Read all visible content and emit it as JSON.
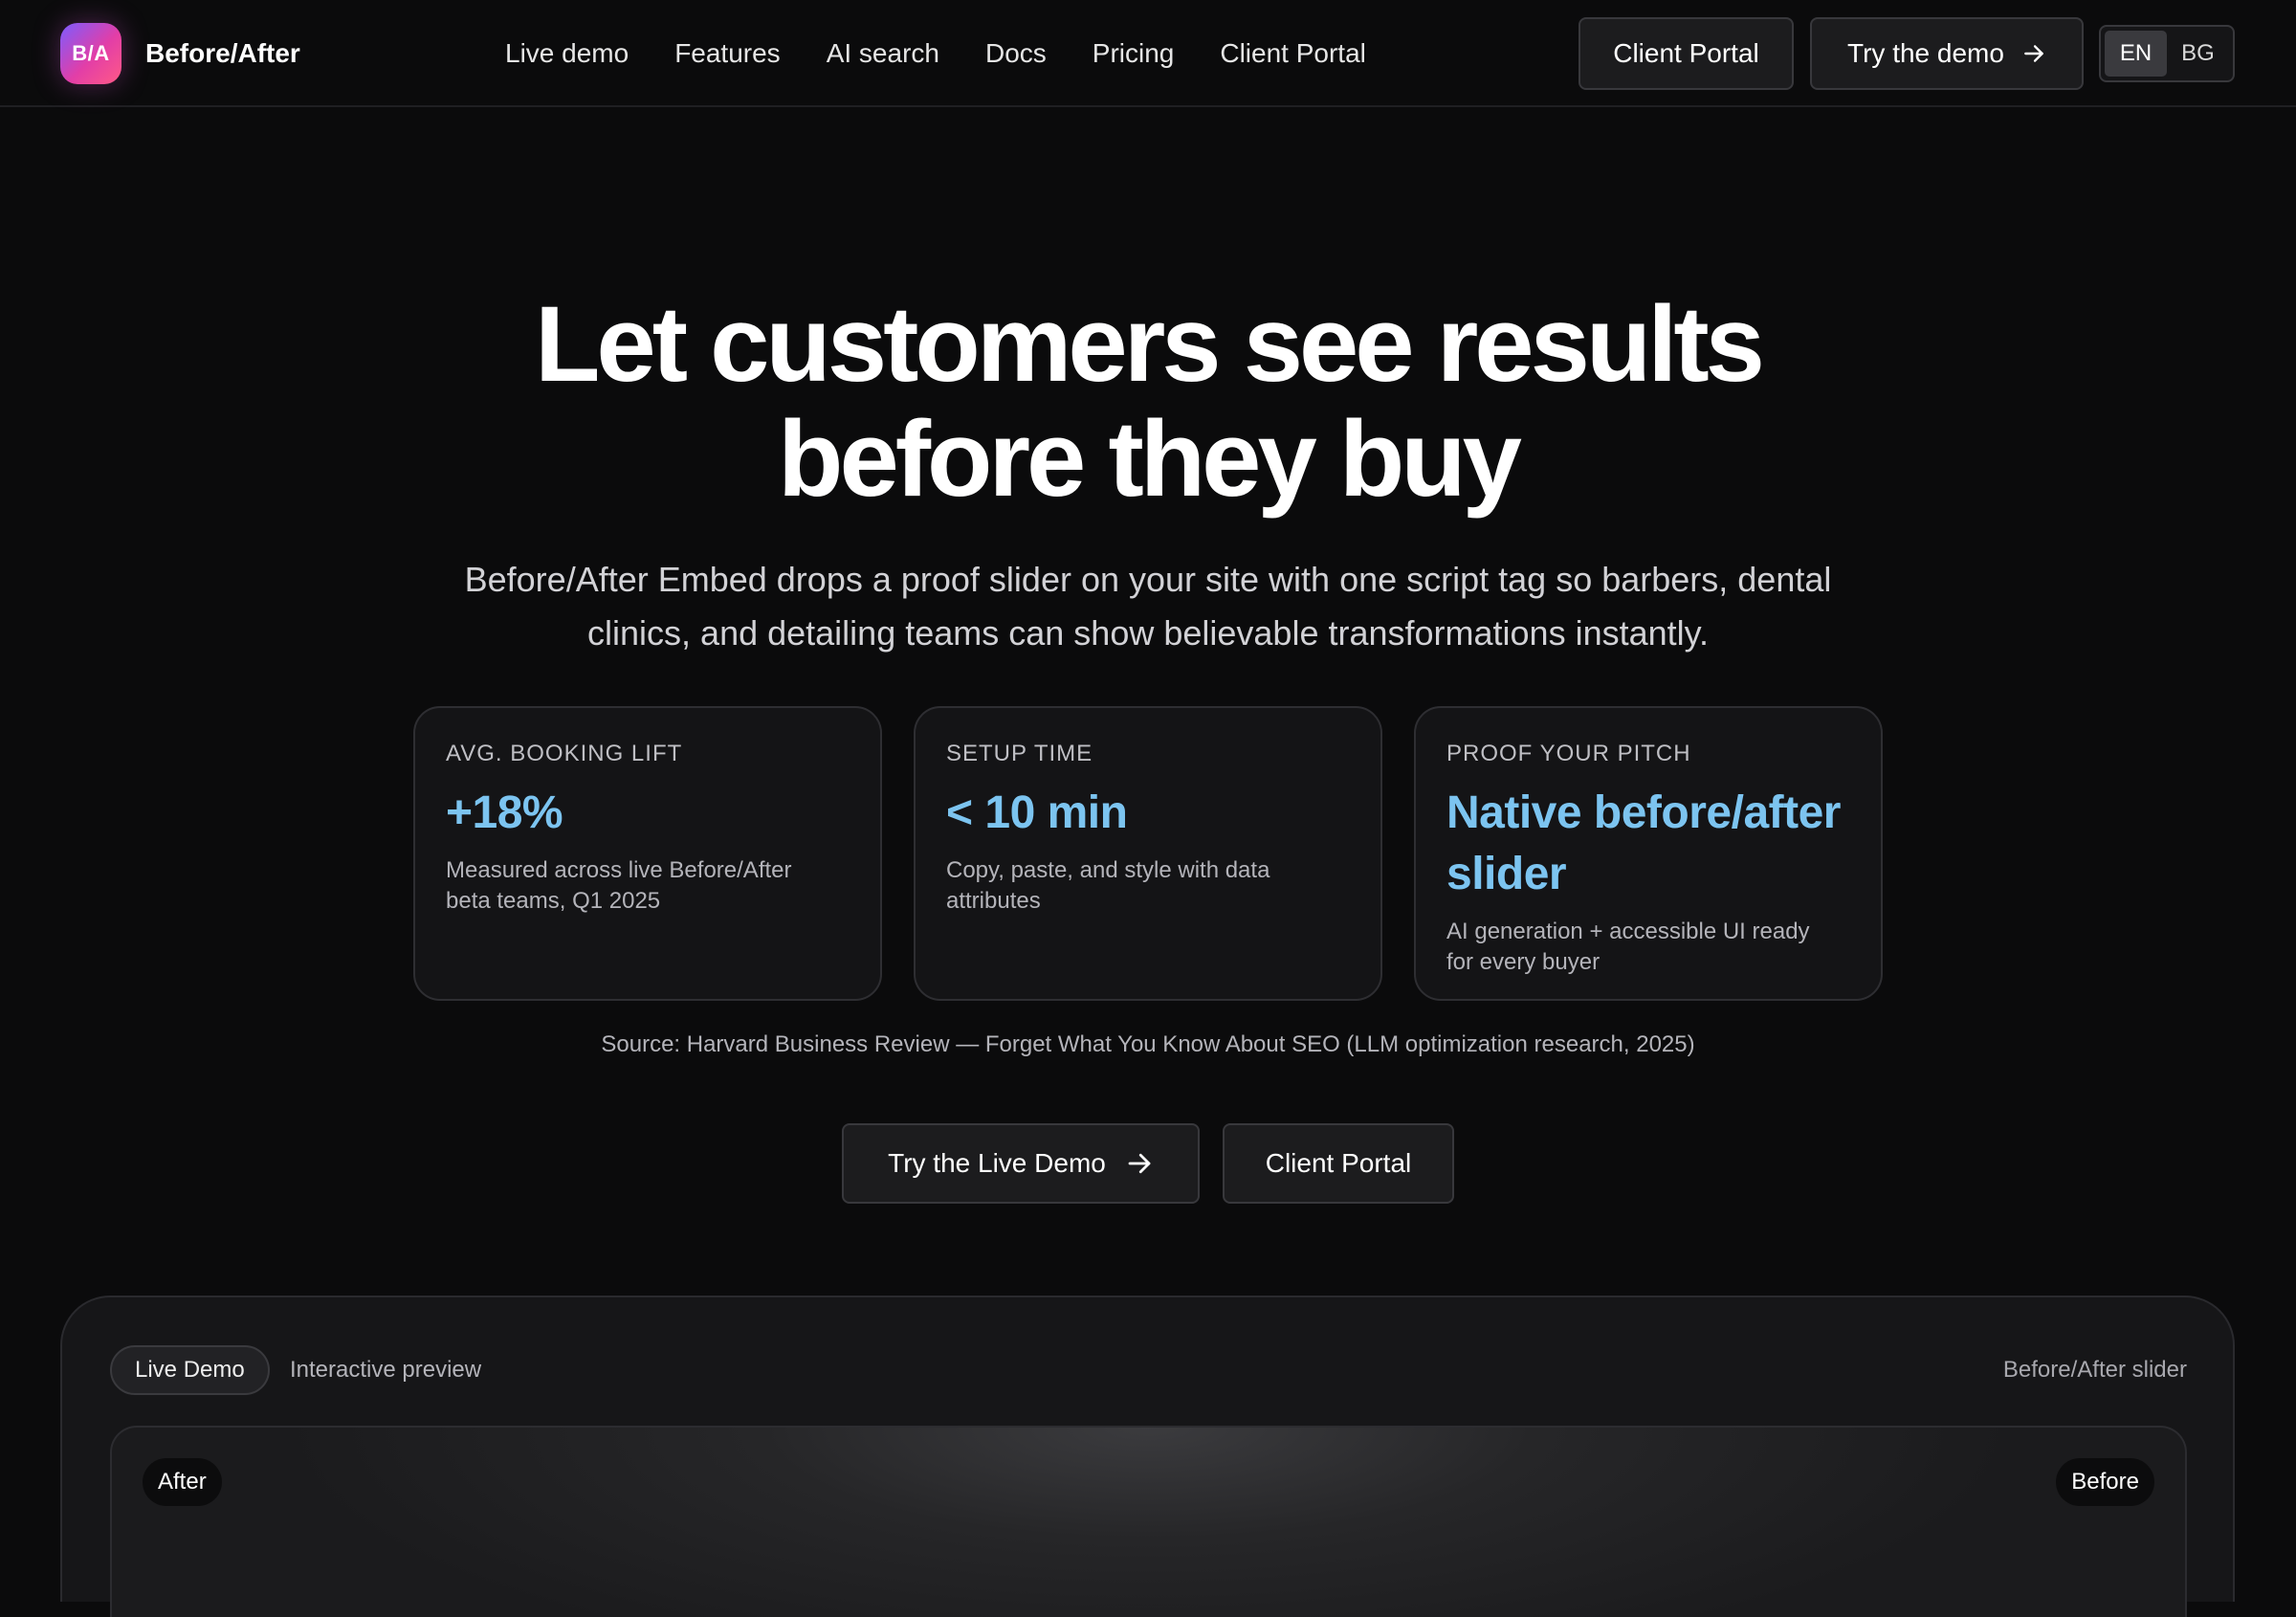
{
  "header": {
    "logo_text": "B/A",
    "brand_name": "Before/After",
    "nav": [
      "Live demo",
      "Features",
      "AI search",
      "Docs",
      "Pricing",
      "Client Portal"
    ],
    "client_portal_label": "Client Portal",
    "try_demo_label": "Try the demo",
    "languages": [
      "EN",
      "BG"
    ],
    "active_language": "EN"
  },
  "hero": {
    "title_line1": "Let customers see results",
    "title_line2": "before they buy",
    "subtitle_line1": "Before/After Embed drops a proof slider on your site with one script tag so barbers, dental",
    "subtitle_line2": "clinics, and detailing teams can show believable transformations instantly."
  },
  "stats": [
    {
      "label": "AVG. BOOKING LIFT",
      "value": "+18%",
      "note_line1": "Measured across live Before/After",
      "note_line2": "beta teams, Q1 2025"
    },
    {
      "label": "SETUP TIME",
      "value": "< 10 min",
      "note_line1": "Copy, paste, and style with data",
      "note_line2": "attributes"
    },
    {
      "label": "PROOF YOUR PITCH",
      "value_line1": "Native before/after",
      "value_line2": "slider",
      "note_line1": "AI generation + accessible UI ready",
      "note_line2": "for every buyer"
    }
  ],
  "source": "Source: Harvard Business Review — Forget What You Know About SEO (LLM optimization research, 2025)",
  "cta": {
    "primary_label": "Try the Live Demo",
    "secondary_label": "Client Portal"
  },
  "demo": {
    "pill_label": "Live Demo",
    "pill_desc": "Interactive preview",
    "right_label": "Before/After slider",
    "after_tag": "After",
    "before_tag": "Before"
  },
  "colors": {
    "accent": "#7cc4f0",
    "background": "#0b0b0c",
    "logo_gradient": [
      "#7c5cff",
      "#e23ea7",
      "#ff5a86"
    ]
  },
  "icons": {
    "arrow": "arrow-right-icon"
  }
}
